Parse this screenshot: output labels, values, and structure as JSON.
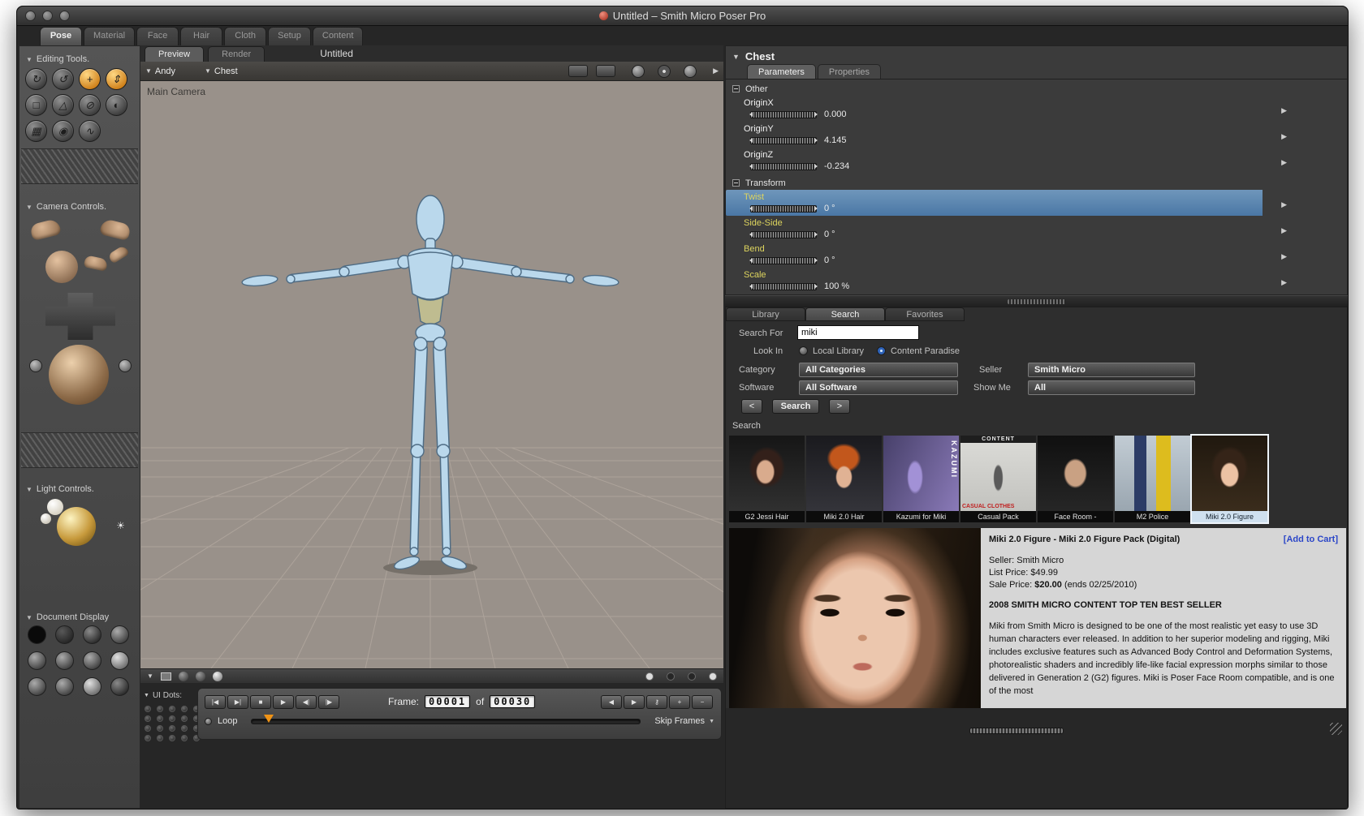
{
  "window": {
    "title": "Untitled – Smith Micro Poser Pro"
  },
  "room_tabs": [
    "Pose",
    "Material",
    "Face",
    "Hair",
    "Cloth",
    "Setup",
    "Content"
  ],
  "sidebar": {
    "editing_tools": "Editing Tools.",
    "camera_controls": "Camera Controls.",
    "light_controls": "Light Controls.",
    "document_display": "Document Display"
  },
  "viewport": {
    "preview_tab": "Preview",
    "render_tab": "Render",
    "doc_title": "Untitled",
    "actor_menu": "Andy",
    "part_menu": "Chest",
    "camera_name": "Main Camera"
  },
  "timeline": {
    "ui_dots": "UI Dots:",
    "transport": [
      "|◀",
      "▶|",
      "■",
      "▶",
      "◀|",
      "|▶"
    ],
    "frame_label": "Frame:",
    "current_frame": "00001",
    "of": "of",
    "total_frames": "00030",
    "edit_buttons": [
      "◀",
      "▶",
      "⚷",
      "+",
      "−"
    ],
    "loop": "Loop",
    "skip_frames": "Skip Frames"
  },
  "params": {
    "header": "Chest",
    "tab_parameters": "Parameters",
    "tab_properties": "Properties",
    "groups": [
      {
        "name": "Other",
        "rows": [
          {
            "label": "OriginX",
            "value": "0.000"
          },
          {
            "label": "OriginY",
            "value": "4.145"
          },
          {
            "label": "OriginZ",
            "value": "-0.234"
          }
        ]
      },
      {
        "name": "Transform",
        "rows": [
          {
            "label": "Twist",
            "value": "0 °"
          },
          {
            "label": "Side-Side",
            "value": "0 °"
          },
          {
            "label": "Bend",
            "value": "0 °"
          },
          {
            "label": "Scale",
            "value": "100 %"
          }
        ]
      }
    ]
  },
  "library": {
    "tabs": [
      "Library",
      "Search",
      "Favorites"
    ],
    "search_for_label": "Search For",
    "search_value": "miki",
    "look_in_label": "Look In",
    "radio_local": "Local Library",
    "radio_paradise": "Content Paradise",
    "category_label": "Category",
    "category_value": "All Categories",
    "seller_label": "Seller",
    "seller_value": "Smith Micro",
    "software_label": "Software",
    "software_value": "All Software",
    "show_me_label": "Show Me",
    "show_me_value": "All",
    "prev_button": "<",
    "search_button": "Search",
    "next_button": ">",
    "results_header": "Search",
    "results": [
      {
        "label": "G2 Jessi Hair"
      },
      {
        "label": "Miki 2.0 Hair"
      },
      {
        "label": "Kazumi for Miki",
        "overlay": "KAZUMI"
      },
      {
        "label": "Casual Pack",
        "overlay": "CASUAL CLOTHES",
        "overlay2": "CONTENT"
      },
      {
        "label": "Face Room -"
      },
      {
        "label": "M2 Police"
      },
      {
        "label": "Miki 2.0 Figure"
      }
    ]
  },
  "product": {
    "title": "Miki 2.0 Figure - Miki 2.0 Figure Pack (Digital)",
    "add_to_cart": "[Add to Cart]",
    "seller": "Seller: Smith Micro",
    "list_price": "List Price: $49.99",
    "sale_label": "Sale Price: ",
    "sale_price": "$20.00",
    "sale_note": " (ends 02/25/2010)",
    "best_seller": "2008 SMITH MICRO CONTENT TOP TEN BEST SELLER",
    "description": "Miki from Smith Micro is designed to be one of the most realistic yet easy to use 3D human characters ever released. In addition to her superior modeling and rigging, Miki includes exclusive features such as Advanced Body Control and Deformation Systems, photorealistic shaders and incredibly life-like facial expression morphs similar to those delivered in Generation 2 (G2) figures. Miki is Poser Face Room compatible, and is one of the most"
  },
  "icons": {
    "disclosure": "▼",
    "disclosure_right": "▶",
    "dropdown": "▼",
    "sun": "☀",
    "tools": [
      "↻",
      "↺",
      "+",
      "⇕",
      "□",
      "△",
      "⊘",
      "◐",
      "▦",
      "◉",
      "∿"
    ]
  }
}
